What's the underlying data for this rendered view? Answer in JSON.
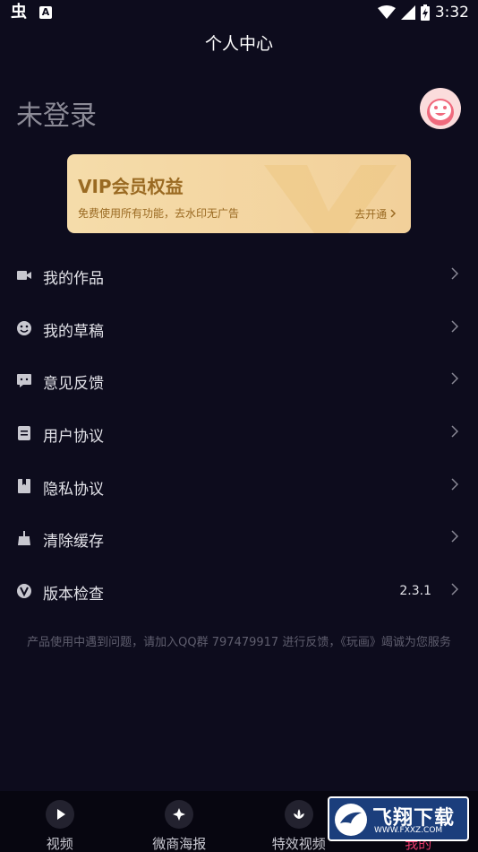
{
  "status_bar": {
    "time": "3:32",
    "left_icons": [
      "bug-icon",
      "a-icon"
    ],
    "right_icons": [
      "wifi-icon",
      "signal-icon",
      "battery-icon"
    ]
  },
  "header": {
    "title": "个人中心"
  },
  "profile": {
    "login_label": "未登录",
    "avatar_icon": "avatar-face-icon"
  },
  "vip": {
    "title": "VIP会员权益",
    "description": "免费使用所有功能，去水印无广告",
    "action": "去开通"
  },
  "menu": [
    {
      "label": "我的作品",
      "icon": "video-camera-icon",
      "value": ""
    },
    {
      "label": "我的草稿",
      "icon": "smiley-icon",
      "value": ""
    },
    {
      "label": "意见反馈",
      "icon": "chat-icon",
      "value": ""
    },
    {
      "label": "用户协议",
      "icon": "document-icon",
      "value": ""
    },
    {
      "label": "隐私协议",
      "icon": "bookmark-icon",
      "value": ""
    },
    {
      "label": "清除缓存",
      "icon": "broom-icon",
      "value": ""
    },
    {
      "label": "版本检查",
      "icon": "version-v-icon",
      "value": "2.3.1"
    }
  ],
  "footer_note": "产品使用中遇到问题，请加入QQ群 797479917 进行反馈，《玩画》竭诚为您服务",
  "tabs": [
    {
      "label": "视频",
      "icon": "play-icon",
      "active": false
    },
    {
      "label": "微商海报",
      "icon": "sparkle-icon",
      "active": false
    },
    {
      "label": "特效视频",
      "icon": "lotus-icon",
      "active": false
    },
    {
      "label": "我的",
      "icon": "profile-icon",
      "active": true
    }
  ],
  "watermark": {
    "text": "飞翔下载",
    "url": "WWW.FXXZ.COM"
  },
  "colors": {
    "background": "#0d0c1d",
    "vip_gold": "#f5dcaa",
    "vip_text": "#9a6a22",
    "active_tab": "#ec3a6c"
  }
}
